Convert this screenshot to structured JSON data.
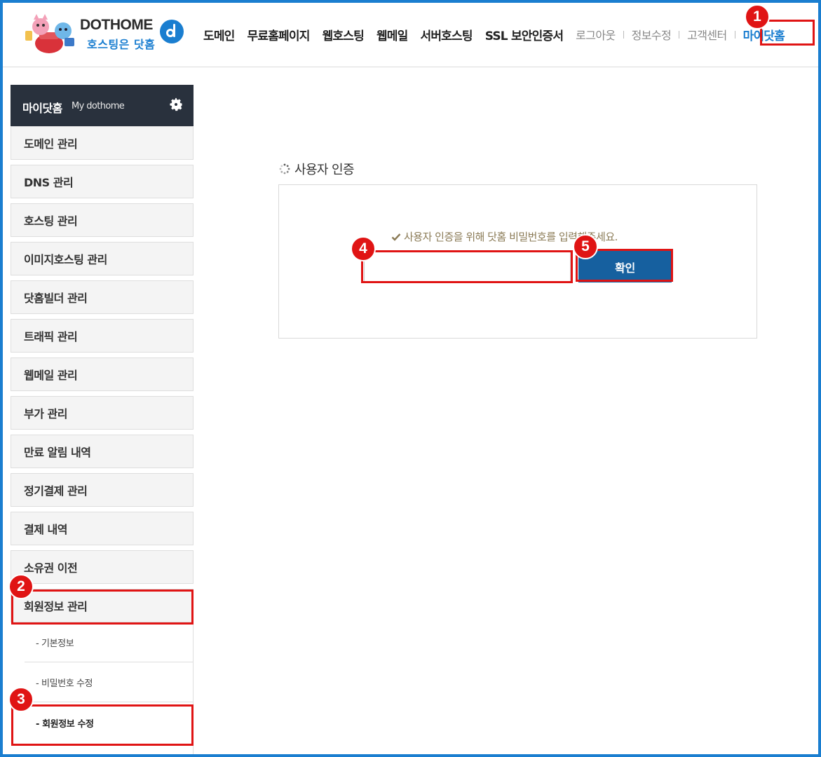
{
  "header": {
    "logo": {
      "brand": "DOTHOME",
      "tagline": "호스팅은 닷홈"
    },
    "nav_main": [
      "도메인",
      "무료홈페이지",
      "웹호스팅",
      "웹메일",
      "서버호스팅",
      "SSL 보안인증서"
    ],
    "nav_util": [
      "로그아웃",
      "정보수정",
      "고객센터"
    ],
    "nav_active": "마이닷홈"
  },
  "sidebar": {
    "title": "마이닷홈",
    "subtitle": "My dothome",
    "settings_icon": "gear-icon",
    "items": [
      "도메인 관리",
      "DNS 관리",
      "호스팅 관리",
      "이미지호스팅 관리",
      "닷홈빌더 관리",
      "트래픽 관리",
      "웹메일 관리",
      "부가 관리",
      "만료 알림 내역",
      "정기결제 관리",
      "결제 내역",
      "소유권 이전",
      "회원정보 관리"
    ],
    "subitems": [
      "- 기본정보",
      "- 비밀번호 수정",
      "- 회원정보 수정"
    ]
  },
  "main": {
    "section_title": "사용자 인증",
    "notice": "사용자 인증을 위해 닷홈 비밀번호를 입력해주세요.",
    "password_value": "",
    "confirm_label": "확인"
  },
  "annotations": {
    "badges": [
      "1",
      "2",
      "3",
      "4",
      "5"
    ],
    "color": "#e01414"
  },
  "colors": {
    "accent": "#1a7ed0",
    "sidebar_header": "#29313d",
    "button": "#16609f",
    "notice_text": "#8a7a55"
  }
}
